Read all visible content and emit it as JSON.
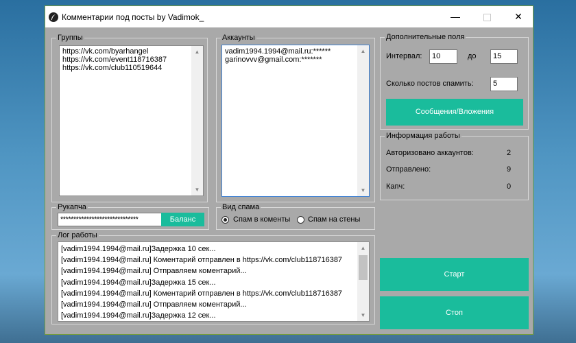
{
  "window": {
    "title": "Комментарии под посты by Vadimok_"
  },
  "groups": {
    "legend": "Группы",
    "items": [
      "https://vk.com/byarhangel",
      "https://vk.com/event118716387",
      "https://vk.com/club110519644"
    ]
  },
  "accounts": {
    "legend": "Аккаунты",
    "items": [
      "vadim1994.1994@mail.ru:******",
      "garinovvv@gmail.com:*******"
    ]
  },
  "extra": {
    "legend": "Дополнительные поля",
    "interval_label": "Интервал:",
    "interval_from": "10",
    "to_label": "до",
    "interval_to": "15",
    "posts_label": "Сколько постов спамить:",
    "posts_value": "5",
    "messages_button": "Сообщения/Вложения"
  },
  "info": {
    "legend": "Информация работы",
    "authorized_label": "Авторизовано аккаунтов:",
    "authorized_value": "2",
    "sent_label": "Отправлено:",
    "sent_value": "9",
    "captcha_label": "Капч:",
    "captcha_value": "0"
  },
  "rucaptcha": {
    "legend": "Рукапча",
    "key_value": "******************************",
    "balance_button": "Баланс"
  },
  "spam_type": {
    "legend": "Вид спама",
    "option_comments": "Спам в коменты",
    "option_walls": "Спам на стены",
    "selected": "comments"
  },
  "log": {
    "legend": "Лог работы",
    "lines": [
      "[vadim1994.1994@mail.ru]Задержка 10 сек...",
      "[vadim1994.1994@mail.ru] Коментарий отправлен в https://vk.com/club118716387",
      "[vadim1994.1994@mail.ru] Отправляем коментарий...",
      "[vadim1994.1994@mail.ru]Задержка 15 сек...",
      "[vadim1994.1994@mail.ru] Коментарий отправлен в https://vk.com/club118716387",
      "[vadim1994.1994@mail.ru] Отправляем коментарий...",
      "[vadim1994.1994@mail.ru]Задержка 12 сек..."
    ]
  },
  "actions": {
    "start_button": "Старт",
    "stop_button": "Стоп"
  },
  "colors": {
    "accent": "#1abc9c",
    "window_bg": "#a9a9a9"
  }
}
